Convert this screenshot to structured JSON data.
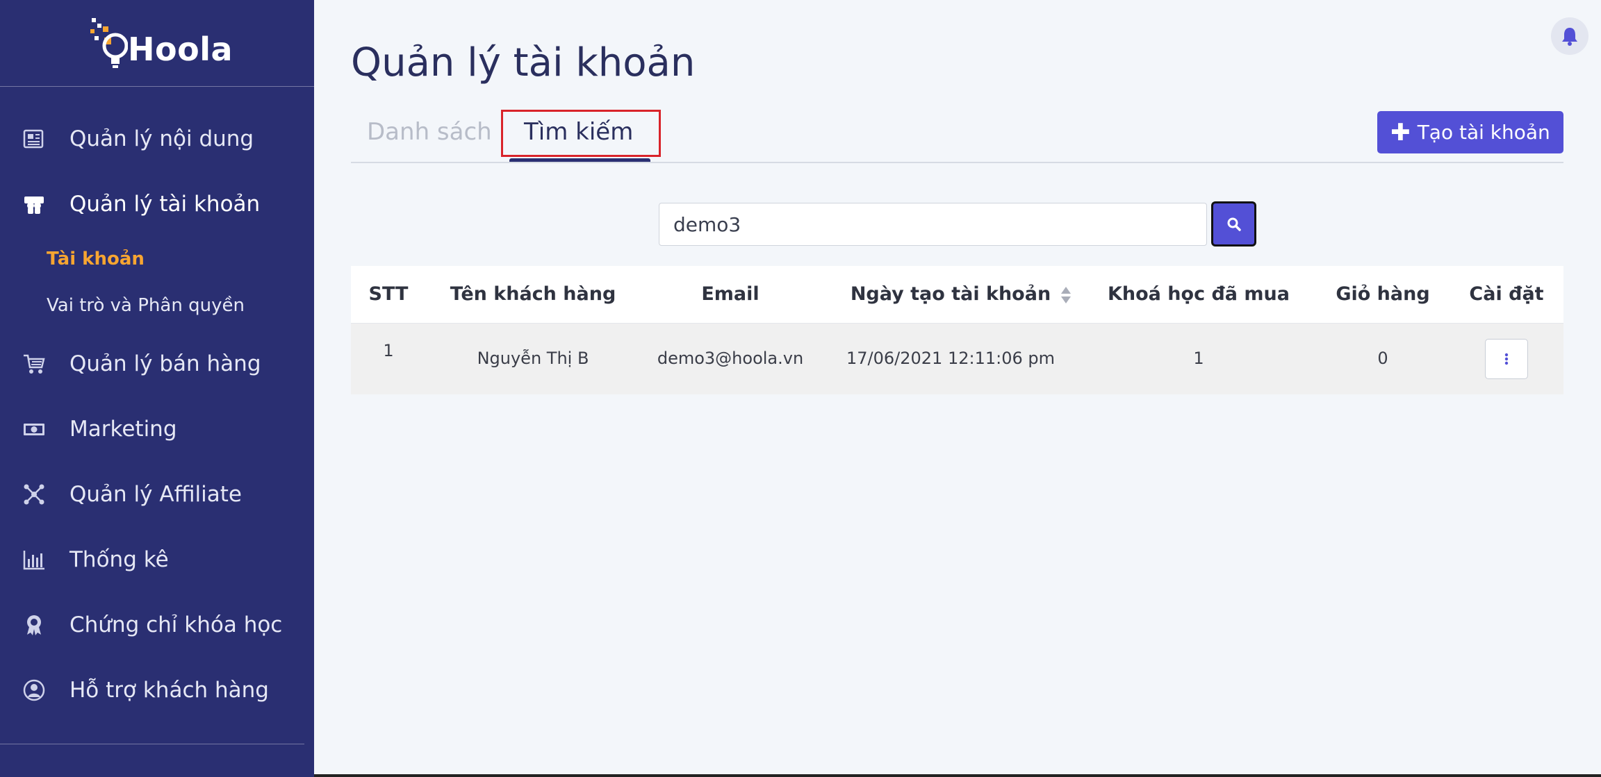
{
  "brand": {
    "name": "Hoola",
    "accent": "#5350d6",
    "sidebar_bg": "#2a2f72",
    "highlight": "#f7a531"
  },
  "sidebar": {
    "items": [
      {
        "label": "Quản lý nội dung",
        "icon": "newspaper-icon"
      },
      {
        "label": "Quản lý tài khoản",
        "icon": "users-icon",
        "active": true
      },
      {
        "label": "Quản lý bán hàng",
        "icon": "cart-icon"
      },
      {
        "label": "Marketing",
        "icon": "money-icon"
      },
      {
        "label": "Quản lý Affiliate",
        "icon": "network-icon"
      },
      {
        "label": "Thống kê",
        "icon": "bar-chart-icon"
      },
      {
        "label": "Chứng chỉ khóa học",
        "icon": "award-icon"
      },
      {
        "label": "Hỗ trợ khách hàng",
        "icon": "user-circle-icon"
      }
    ],
    "subitems": [
      {
        "label": "Tài khoản",
        "active": true
      },
      {
        "label": "Vai trò và Phân quyền"
      }
    ]
  },
  "header": {
    "title": "Quản lý tài khoản"
  },
  "tabs": [
    {
      "label": "Danh sách"
    },
    {
      "label": "Tìm kiếm",
      "active": true
    }
  ],
  "toolbar": {
    "create_label": "Tạo tài khoản"
  },
  "search": {
    "value": "demo3"
  },
  "table": {
    "columns": [
      "STT",
      "Tên khách hàng",
      "Email",
      "Ngày tạo tài khoản",
      "Khoá học đã mua",
      "Giỏ hàng",
      "Cài đặt"
    ],
    "rows": [
      {
        "stt": "1",
        "name": "Nguyễn Thị B",
        "email": "demo3@hoola.vn",
        "created": "17/06/2021 12:11:06 pm",
        "courses": "1",
        "cart": "0"
      }
    ]
  }
}
